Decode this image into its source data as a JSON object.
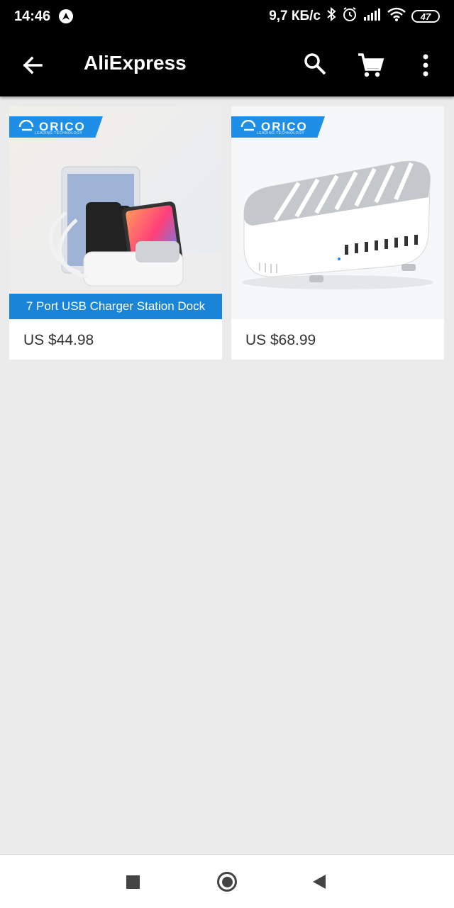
{
  "status_bar": {
    "time": "14:46",
    "network_speed": "9,7 КБ/с",
    "battery": "47",
    "icons": [
      "nav-app-icon",
      "bluetooth-icon",
      "alarm-icon",
      "signal-icon",
      "wifi-icon",
      "battery-icon"
    ]
  },
  "app_bar": {
    "title": "AliExpress",
    "icons": [
      "back-arrow-icon",
      "search-icon",
      "cart-icon",
      "more-vert-icon"
    ]
  },
  "products": [
    {
      "brand": "ORICO",
      "brand_tagline": "LEADING TECHNOLOGY",
      "caption": "7 Port USB Charger Station Dock",
      "price": "US $44.98"
    },
    {
      "brand": "ORICO",
      "brand_tagline": "LEADING TECHNOLOGY",
      "caption": "",
      "price": "US $68.99"
    }
  ],
  "colors": {
    "app_bar": "#000000",
    "background": "#ebebeb",
    "orico_blue": "#1e8ee6"
  },
  "bottom_nav": {
    "icons": [
      "recents-square-icon",
      "home-circle-icon",
      "back-triangle-icon"
    ]
  }
}
